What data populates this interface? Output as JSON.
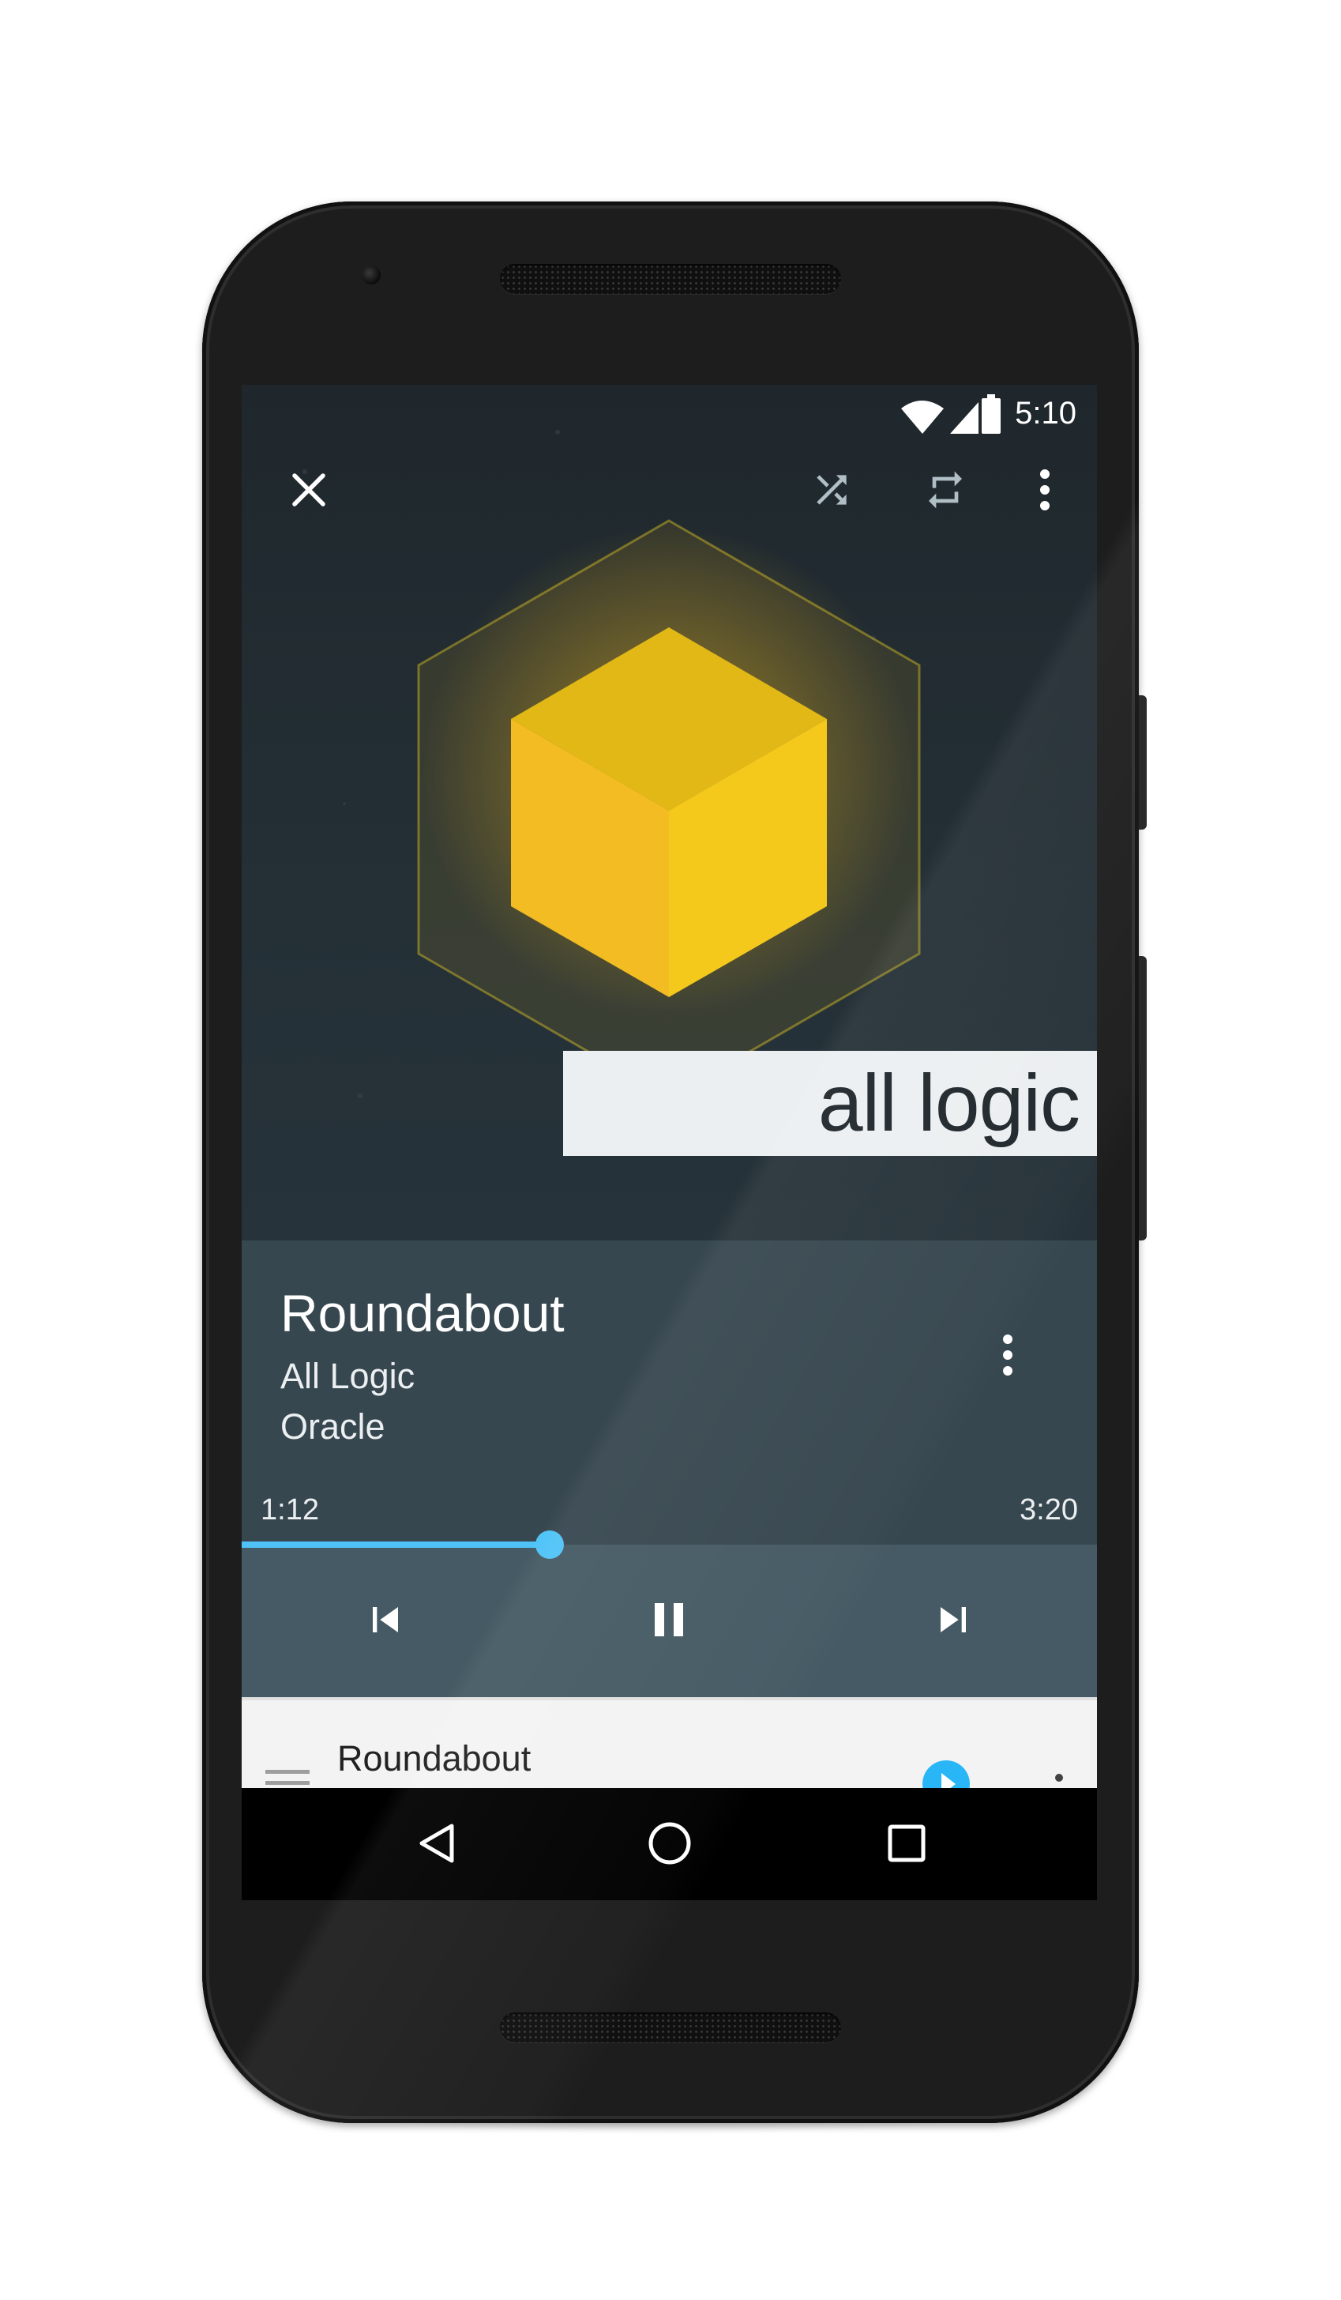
{
  "status_bar": {
    "time": "5:10",
    "icons": [
      "wifi-icon",
      "cell-signal-icon",
      "battery-icon"
    ]
  },
  "toolbar": {
    "close_icon": "close-icon",
    "shuffle_icon": "shuffle-icon",
    "repeat_icon": "repeat-icon",
    "more_icon": "more-vert-icon"
  },
  "album_art": {
    "label": "all logic",
    "cube_color": "#f5c518"
  },
  "now_playing": {
    "title": "Roundabout",
    "artist": "All Logic",
    "album": "Oracle",
    "elapsed": "1:12",
    "duration": "3:20",
    "progress": 0.36
  },
  "controls": {
    "previous_icon": "skip-previous-icon",
    "pause_icon": "pause-icon",
    "next_icon": "skip-next-icon"
  },
  "queue": {
    "items": [
      {
        "title": "Roundabout",
        "playing": true
      }
    ]
  },
  "navbar": {
    "back_icon": "back-icon",
    "home_icon": "home-icon",
    "recents_icon": "recents-icon"
  },
  "colors": {
    "accent": "#4fc3f7",
    "info_background": "#37474f",
    "controls_background": "#455a64",
    "art_background": "#222c32"
  }
}
